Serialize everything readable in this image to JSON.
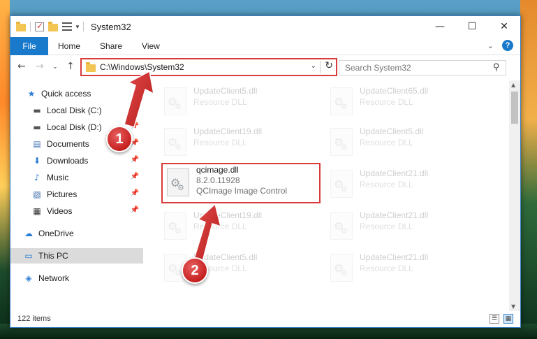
{
  "window": {
    "title": "System32",
    "minimize_glyph": "—",
    "maximize_glyph": "☐",
    "close_glyph": "✕"
  },
  "ribbon": {
    "tabs": [
      "File",
      "Home",
      "Share",
      "View"
    ],
    "help_glyph": "?"
  },
  "address": {
    "path": "C:\\Windows\\System32",
    "search_placeholder": "Search System32"
  },
  "nav": {
    "items": [
      {
        "label": "Quick access",
        "icon": "star-icon",
        "glyph": "★",
        "pinned": false
      },
      {
        "label": "Local Disk (C:)",
        "icon": "drive-icon",
        "glyph": "▬",
        "pinned": true
      },
      {
        "label": "Local Disk (D:)",
        "icon": "drive-icon",
        "glyph": "▬",
        "pinned": true
      },
      {
        "label": "Documents",
        "icon": "documents-icon",
        "glyph": "▤",
        "pinned": true
      },
      {
        "label": "Downloads",
        "icon": "download-icon",
        "glyph": "⬇",
        "pinned": true
      },
      {
        "label": "Music",
        "icon": "music-icon",
        "glyph": "♪",
        "pinned": true
      },
      {
        "label": "Pictures",
        "icon": "pictures-icon",
        "glyph": "▧",
        "pinned": true
      },
      {
        "label": "Videos",
        "icon": "videos-icon",
        "glyph": "▦",
        "pinned": true
      },
      {
        "label": "OneDrive",
        "icon": "cloud-icon",
        "glyph": "☁",
        "pinned": false
      },
      {
        "label": "This PC",
        "icon": "computer-icon",
        "glyph": "▭",
        "pinned": false
      },
      {
        "label": "Network",
        "icon": "network-icon",
        "glyph": "◈",
        "pinned": false
      }
    ]
  },
  "files": [
    {
      "name": "UpdateClient5.dll",
      "type": "Resource DLL"
    },
    {
      "name": "UpdateClient65.dll",
      "type": "Resource DLL"
    },
    {
      "name": "UpdateClient19.dll",
      "type": "Resource DLL"
    },
    {
      "name": "UpdateClient5.dll",
      "type": "Resource DLL"
    },
    {
      "name": "qcimage.dll",
      "version": "8.2.0.11928",
      "type": "QCImage Image Control"
    },
    {
      "name": "UpdateClient21.dll",
      "type": "Resource DLL"
    },
    {
      "name": "UpdateClient19.dll",
      "type": "Resource DLL"
    },
    {
      "name": "UpdateClient21.dll",
      "type": "Resource DLL"
    },
    {
      "name": "UpdateClient5.dll",
      "type": "Resource DLL"
    },
    {
      "name": "UpdateClient21.dll",
      "type": "Resource DLL"
    }
  ],
  "status": {
    "item_count": "122 items"
  },
  "annotations": {
    "step1": "1",
    "step2": "2",
    "color": "#d93a3a"
  }
}
